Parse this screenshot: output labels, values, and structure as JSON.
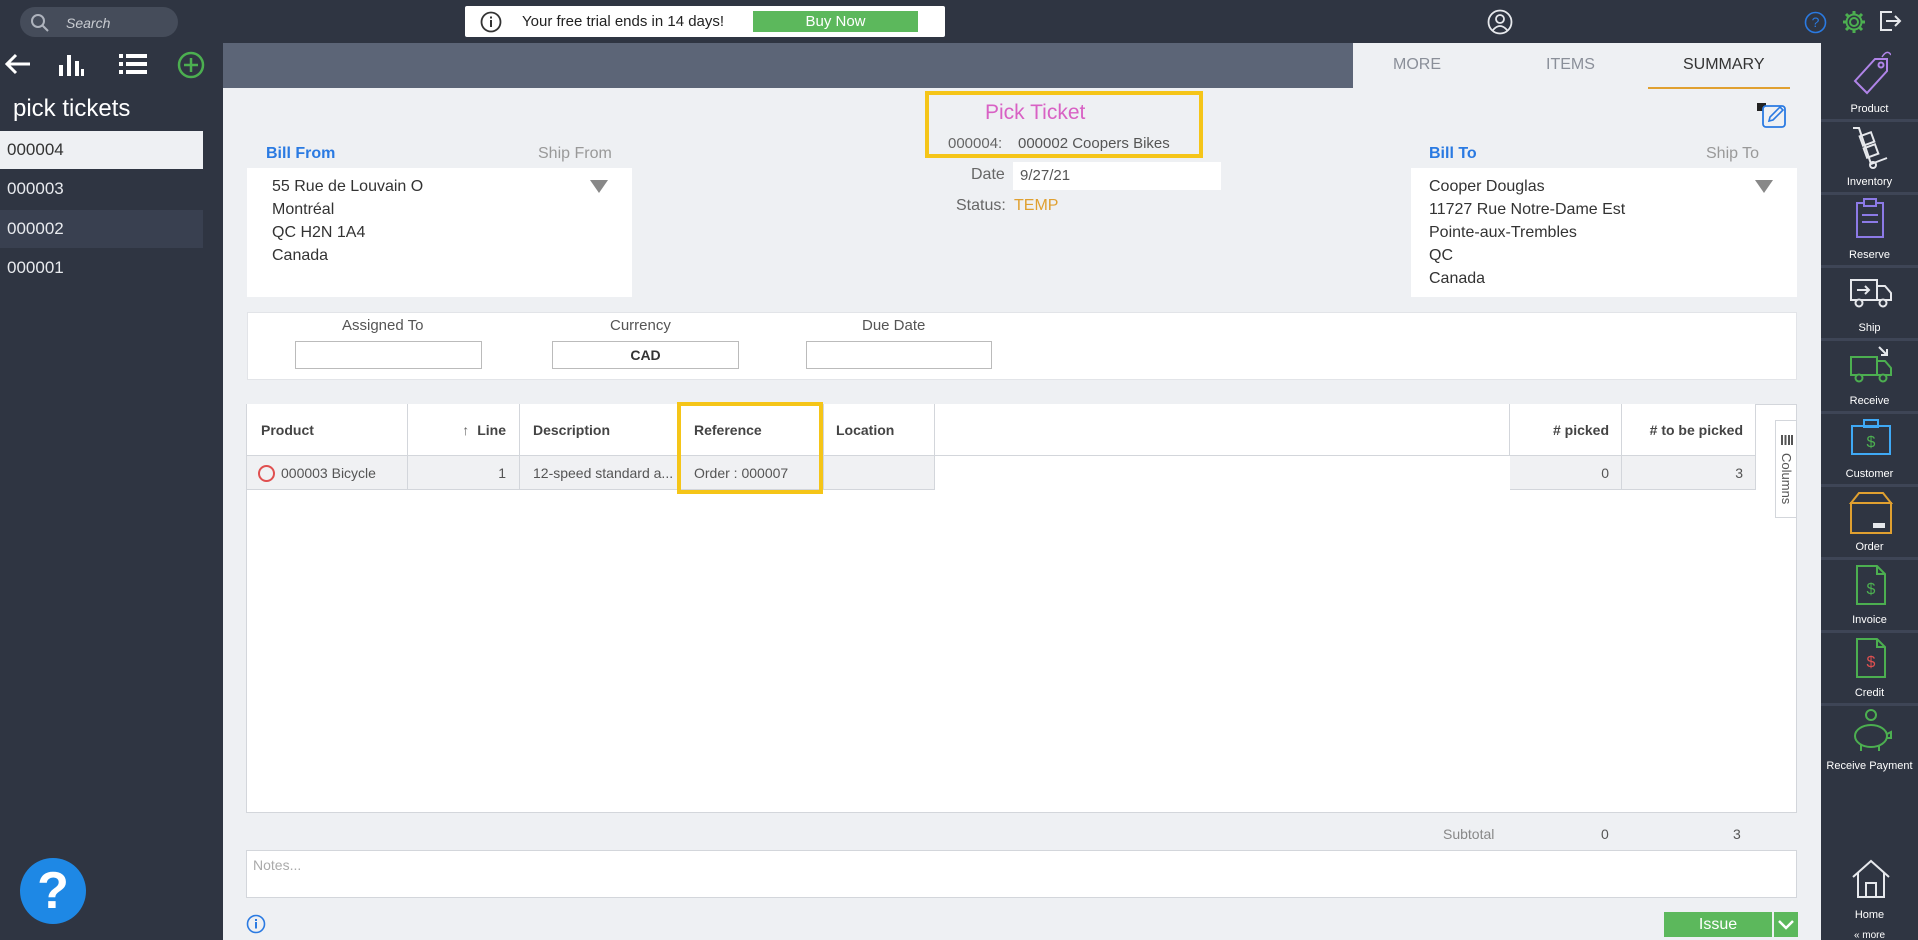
{
  "top": {
    "search_placeholder": "Search",
    "trial_text": "Your free trial ends in 14 days!",
    "buy_label": "Buy Now"
  },
  "left": {
    "title": "pick tickets",
    "items": [
      "000004",
      "000003",
      "000002",
      "000001"
    ],
    "help": "?"
  },
  "tabs": [
    "MORE",
    "ITEMS",
    "SUMMARY"
  ],
  "ticket": {
    "title": "Pick Ticket",
    "number": "000004:",
    "customer": "000002 Coopers Bikes",
    "date_label": "Date",
    "date": "9/27/21",
    "status_label": "Status:",
    "status": "TEMP"
  },
  "bill_from": {
    "label": "Bill From",
    "alt_label": "Ship From",
    "lines": [
      "55 Rue de Louvain O",
      "Montréal",
      "QC H2N 1A4",
      "Canada"
    ]
  },
  "bill_to": {
    "label": "Bill To",
    "alt_label": "Ship To",
    "lines": [
      "Cooper Douglas",
      "11727 Rue Notre-Dame Est",
      "Pointe-aux-Trembles",
      "QC",
      "Canada"
    ]
  },
  "fields": {
    "assigned_label": "Assigned To",
    "assigned_value": "",
    "currency_label": "Currency",
    "currency_value": "CAD",
    "due_label": "Due Date",
    "due_value": ""
  },
  "grid": {
    "headers": [
      "Product",
      "Line",
      "Description",
      "Reference",
      "Location",
      "# picked",
      "# to be picked"
    ],
    "row": {
      "product": "000003 Bicycle",
      "line": "1",
      "description": "12-speed standard a...",
      "reference": "Order : 000007",
      "location": "",
      "picked": "0",
      "to_pick": "3"
    },
    "columns_label": "Columns",
    "subtotal_label": "Subtotal",
    "subtotal_picked": "0",
    "subtotal_to_pick": "3",
    "notes_placeholder": "Notes...",
    "issue_label": "Issue"
  },
  "right_rail": [
    "Product",
    "Inventory",
    "Reserve",
    "Ship",
    "Receive",
    "Customer",
    "Order",
    "Invoice",
    "Credit",
    "Receive Payment",
    "Home",
    "« more"
  ],
  "colors": {
    "accent_green": "#5cb85c",
    "highlight": "#f5c518",
    "title_pink": "#d861c4",
    "link_blue": "#2a7ae2",
    "status_orange": "#e0a030"
  }
}
